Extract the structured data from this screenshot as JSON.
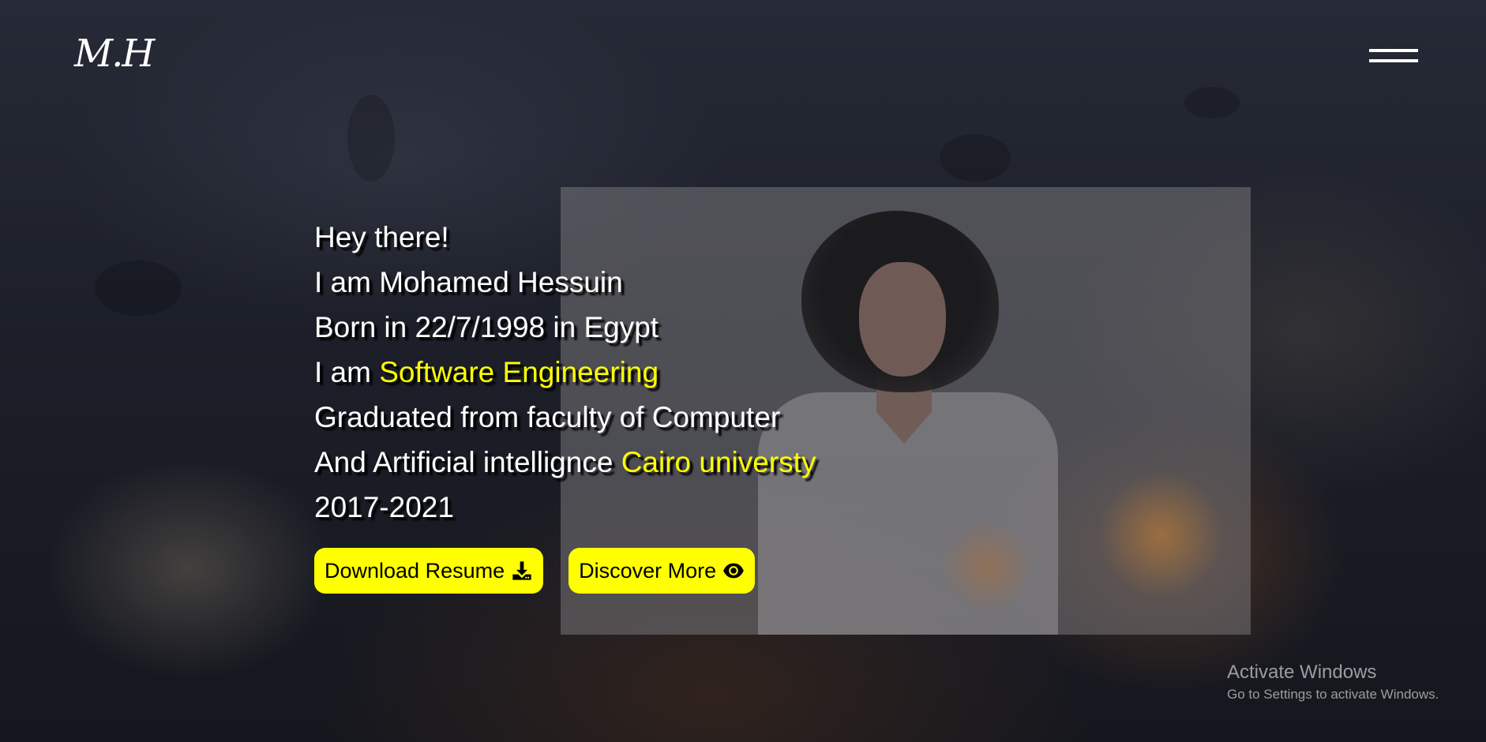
{
  "header": {
    "logo_text": "M.H",
    "menu_icon": "hamburger-icon"
  },
  "hero": {
    "line1": "Hey there!",
    "line2": "I am Mohamed Hessuin",
    "line3": "Born in 22/7/1998 in Egypt",
    "line4_prefix": "I am ",
    "line4_highlight": "Software Engineering",
    "line5": "Graduated from faculty of Computer",
    "line6_prefix": "And Artificial intellignce ",
    "line6_highlight": "Cairo universty",
    "line7": "2017-2021",
    "highlight_color": "#ffff00"
  },
  "buttons": {
    "download_label": "Download Resume",
    "download_icon": "download-icon",
    "discover_label": "Discover More",
    "discover_icon": "eye-icon",
    "button_color": "#ffff00"
  },
  "watermark": {
    "title": "Activate Windows",
    "subtitle": "Go to Settings to activate Windows."
  }
}
